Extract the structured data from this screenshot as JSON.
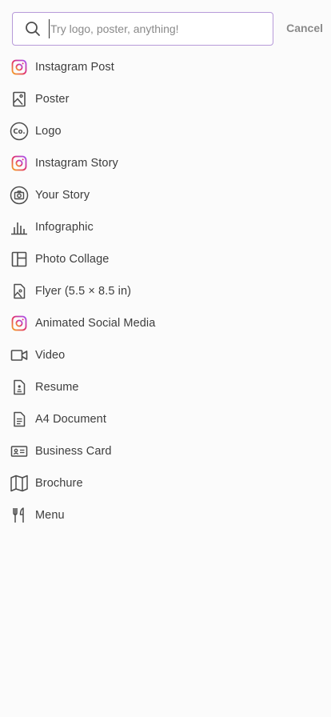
{
  "search": {
    "placeholder": "Try logo, poster, anything!",
    "value": "",
    "cancel_label": "Cancel"
  },
  "colors": {
    "accent_border": "#b79ad9",
    "icon_gray": "#4d4d4d",
    "instagram_gradient": [
      "#f5a623",
      "#e1306c",
      "#a855f7"
    ]
  },
  "items": [
    {
      "label": "Instagram Post",
      "icon": "instagram-icon"
    },
    {
      "label": "Poster",
      "icon": "poster-icon"
    },
    {
      "label": "Logo",
      "icon": "logo-icon"
    },
    {
      "label": "Instagram Story",
      "icon": "instagram-icon"
    },
    {
      "label": "Your Story",
      "icon": "camera-icon"
    },
    {
      "label": "Infographic",
      "icon": "bar-chart-icon"
    },
    {
      "label": "Photo Collage",
      "icon": "collage-icon"
    },
    {
      "label": "Flyer (5.5 × 8.5 in)",
      "icon": "flyer-icon"
    },
    {
      "label": "Animated Social Media",
      "icon": "instagram-icon"
    },
    {
      "label": "Video",
      "icon": "video-icon"
    },
    {
      "label": "Resume",
      "icon": "resume-icon"
    },
    {
      "label": "A4 Document",
      "icon": "document-icon"
    },
    {
      "label": "Business Card",
      "icon": "business-card-icon"
    },
    {
      "label": "Brochure",
      "icon": "brochure-icon"
    },
    {
      "label": "Menu",
      "icon": "menu-icon"
    }
  ]
}
